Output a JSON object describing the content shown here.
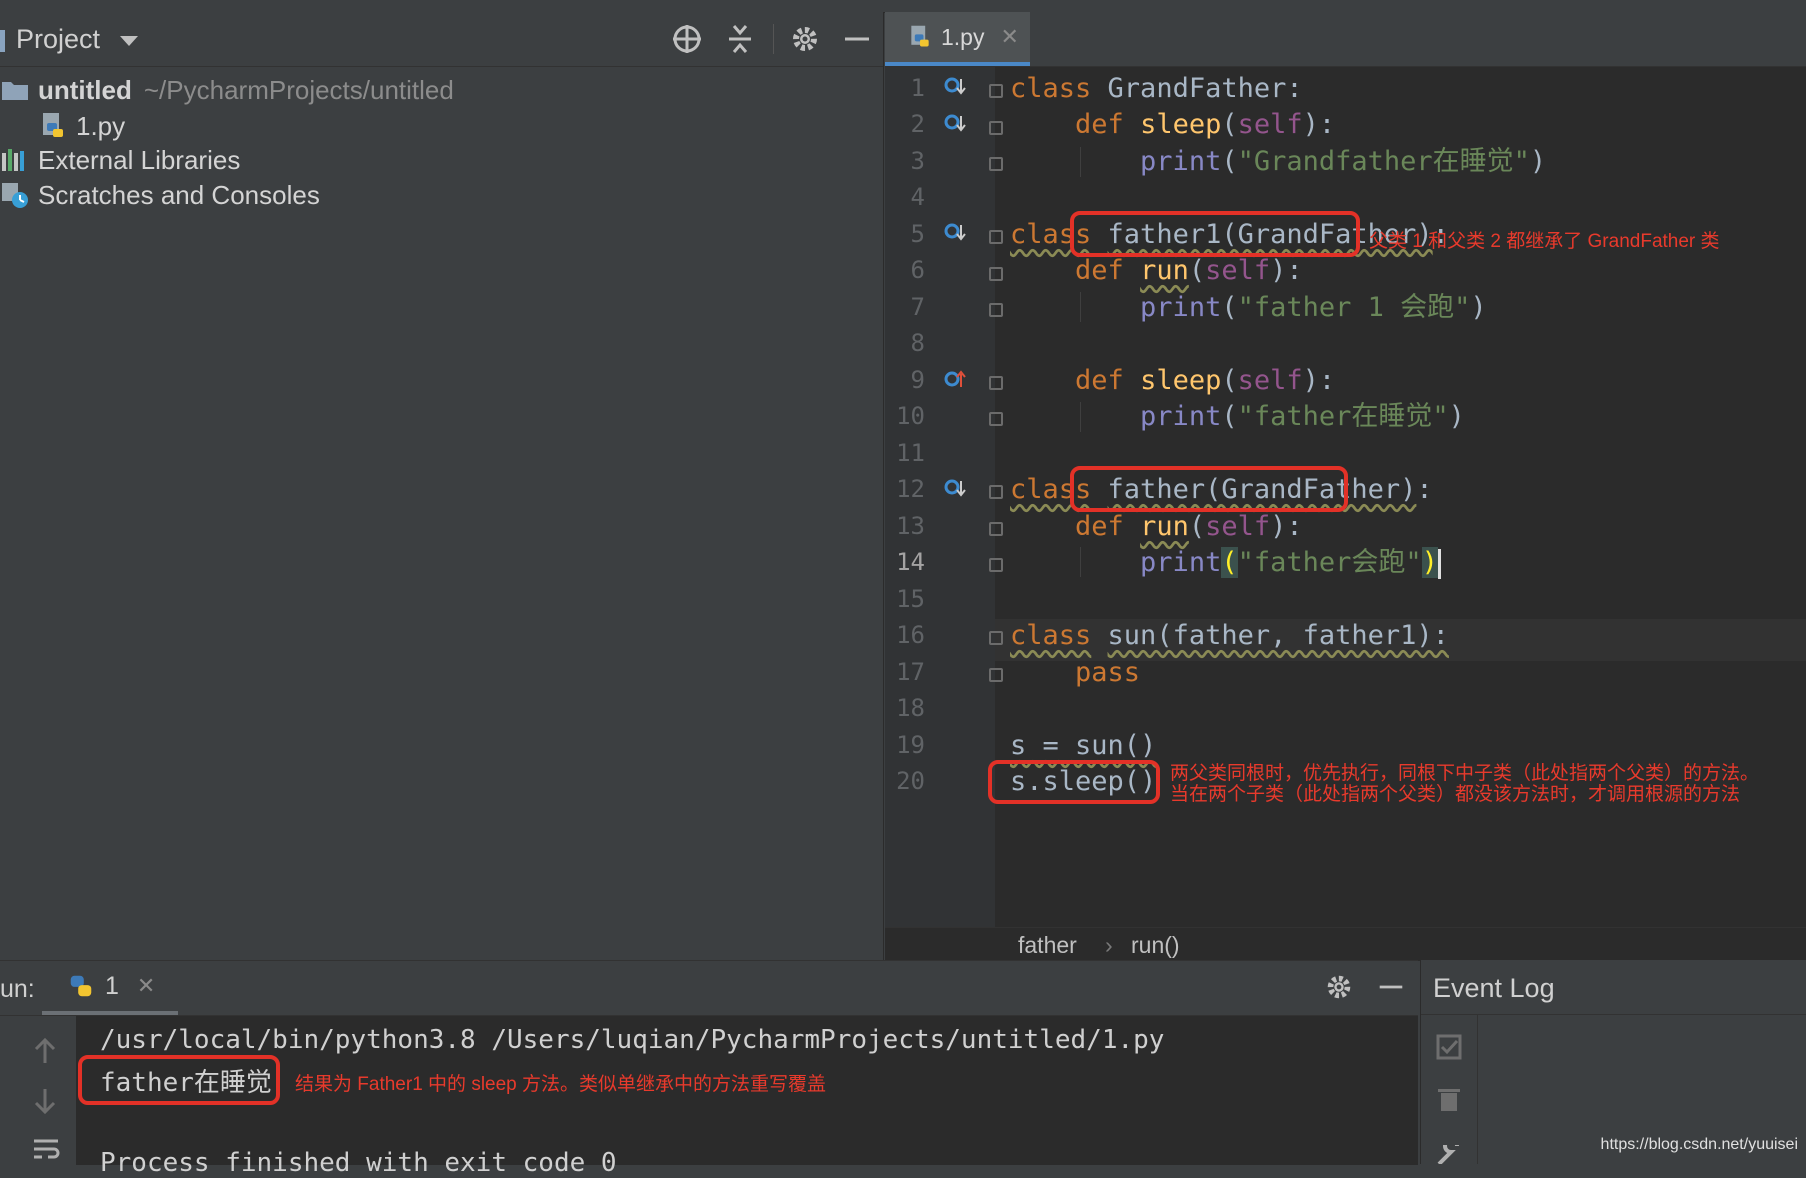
{
  "project": {
    "title": "Project",
    "tree": [
      {
        "label": "untitled",
        "path": "~/PycharmProjects/untitled",
        "icon": "folder-icon"
      },
      {
        "label": "1.py",
        "icon": "python-file-icon"
      },
      {
        "label": "External Libraries",
        "icon": "libraries-icon"
      },
      {
        "label": "Scratches and Consoles",
        "icon": "scratches-icon"
      }
    ]
  },
  "editor": {
    "tab_label": "1.py",
    "line_numbers": [
      "1",
      "2",
      "3",
      "4",
      "5",
      "6",
      "7",
      "8",
      "9",
      "10",
      "11",
      "12",
      "13",
      "14",
      "15",
      "16",
      "17",
      "18",
      "19",
      "20"
    ],
    "current_line": "14",
    "breadcrumb": [
      "father",
      "run()"
    ]
  },
  "code": {
    "l1": {
      "kw": "class",
      "name": "GrandFather",
      "rest": ":"
    },
    "l2": {
      "kw": "def",
      "fn": "sleep",
      "self": "self"
    },
    "l3": {
      "blt": "print",
      "str": "\"Grandfather在睡觉\""
    },
    "l5": {
      "kw": "class",
      "name": "father1(GrandFather)",
      "rest": ":"
    },
    "l6": {
      "kw": "def",
      "fn": "run",
      "self": "self"
    },
    "l7": {
      "blt": "print",
      "str": "\"father 1 会跑\""
    },
    "l9": {
      "kw": "def",
      "fn": "sleep",
      "self": "self"
    },
    "l10": {
      "blt": "print",
      "str": "\"father在睡觉\""
    },
    "l12": {
      "kw": "class",
      "name": "father(GrandFather)",
      "rest": ":"
    },
    "l13": {
      "kw": "def",
      "fn": "run",
      "self": "self"
    },
    "l14": {
      "blt": "print",
      "str": "\"father会跑\""
    },
    "l16": {
      "kw": "class",
      "name": "sun(father, father1):"
    },
    "l17": {
      "kw": "pass"
    },
    "l19": {
      "text": "s = sun()"
    },
    "l20": {
      "text": "s.sleep()"
    }
  },
  "annotations": {
    "a1": "父类 1 和父类 2 都继承了 GrandFather 类",
    "a2_line1": "两父类同根时，优先执行，同根下中子类（此处指两个父类）的方法。",
    "a2_line2": "当在两个子类（此处指两个父类）都没该方法时，才调用根源的方法",
    "a3": "结果为 Father1 中的 sleep 方法。类似单继承中的方法重写覆盖"
  },
  "run": {
    "label": "un:",
    "tab_label": "1",
    "lines": [
      "/usr/local/bin/python3.8 /Users/luqian/PycharmProjects/untitled/1.py",
      "father在睡觉",
      "",
      "Process finished with exit code 0"
    ]
  },
  "event_log": {
    "title": "Event Log"
  },
  "watermark": "https://blog.csdn.net/yuuisei",
  "colors": {
    "accent": "#4a88c7",
    "annotation_red": "#e33127",
    "keyword": "#cc7832",
    "string": "#6a8759"
  }
}
